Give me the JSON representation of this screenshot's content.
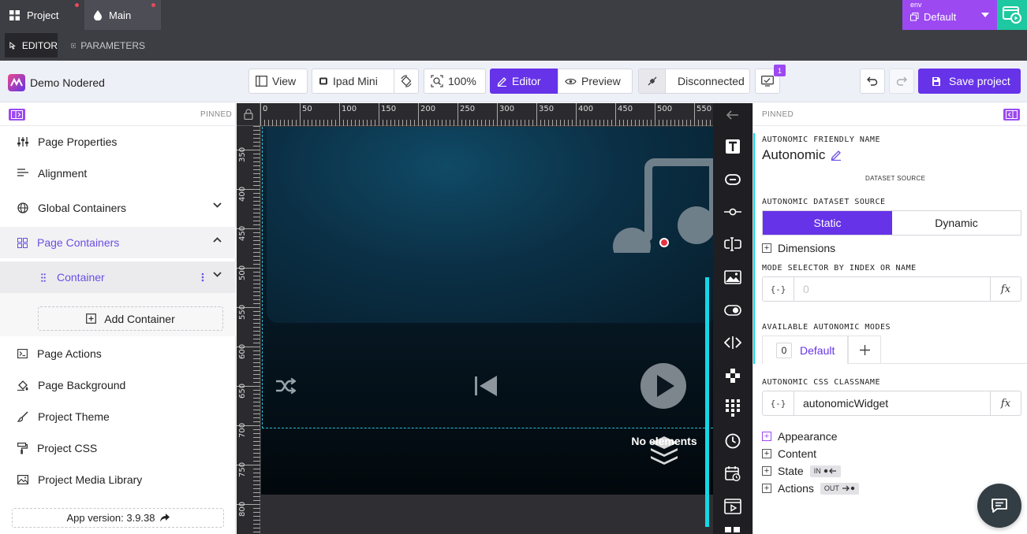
{
  "tabs": [
    {
      "label": "Project"
    },
    {
      "label": "Main"
    }
  ],
  "env": {
    "label": "env",
    "value": "Default"
  },
  "modes": {
    "editor": "EDITOR",
    "parameters": "PARAMETERS"
  },
  "toolbar": {
    "brand": "Demo Nodered",
    "view": "View",
    "device": "Ipad Mini",
    "zoom": "100%",
    "editor": "Editor",
    "preview": "Preview",
    "connection": "Disconnected",
    "notification_count": "1",
    "save": "Save project"
  },
  "left_sidebar": {
    "pinned": "PINNED",
    "items": [
      {
        "label": "Page Properties",
        "icon": "sliders-icon"
      },
      {
        "label": "Alignment",
        "icon": "align-icon"
      },
      {
        "label": "Global Containers",
        "icon": "globe-icon"
      },
      {
        "label": "Page Containers",
        "icon": "grid-icon"
      },
      {
        "label": "Container",
        "icon": "drag-handle-icon"
      },
      {
        "label": "Page Actions",
        "icon": "terminal-icon"
      },
      {
        "label": "Page Background",
        "icon": "paint-bucket-icon"
      },
      {
        "label": "Project Theme",
        "icon": "brush-icon"
      },
      {
        "label": "Project CSS",
        "icon": "roller-icon"
      },
      {
        "label": "Project Media Library",
        "icon": "image-icon"
      }
    ],
    "add_container": "Add Container",
    "app_version": "App version: 3.9.38"
  },
  "canvas": {
    "ruler_top": [
      "0",
      "50",
      "100",
      "150",
      "200",
      "250",
      "300",
      "350",
      "400",
      "450",
      "500",
      "550"
    ],
    "ruler_left": [
      "350",
      "400",
      "450",
      "500",
      "550",
      "600",
      "650",
      "700",
      "750",
      "800"
    ],
    "empty_label": "No elements"
  },
  "right_panel": {
    "pinned": "PINNED",
    "friendly_name_label": "AUTONOMIC FRIENDLY NAME",
    "friendly_name": "Autonomic",
    "dataset_section": "DATASET SOURCE",
    "dataset_source_label": "AUTONOMIC DATASET SOURCE",
    "static": "Static",
    "dynamic": "Dynamic",
    "dimensions": "Dimensions",
    "mode_selector_label": "MODE SELECTOR BY INDEX OR NAME",
    "mode_selector_prefix": "{-}",
    "mode_selector_placeholder": "0",
    "fx": "fx",
    "modes_label": "AVAILABLE AUTONOMIC MODES",
    "mode_index": "0",
    "mode_name": "Default",
    "css_label": "AUTONOMIC CSS CLASSNAME",
    "css_value": "autonomicWidget",
    "appearance": "Appearance",
    "content": "Content",
    "state": "State",
    "state_pill": "IN",
    "actions": "Actions",
    "actions_pill": "OUT"
  },
  "colors": {
    "accent": "#6633e8",
    "env": "#9c49f2",
    "cyan": "#14d7e6",
    "topbar": "#3d3d44"
  }
}
